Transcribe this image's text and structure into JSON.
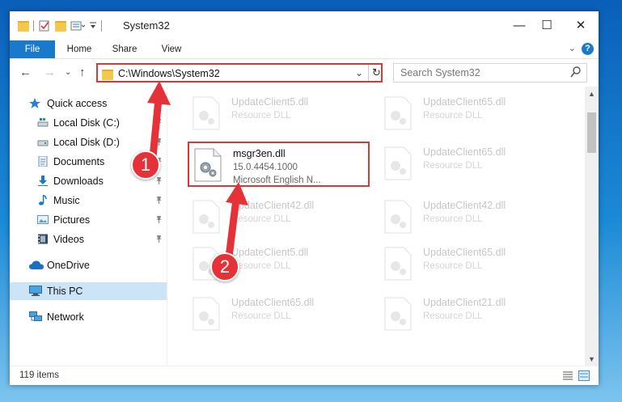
{
  "window": {
    "title": "System32",
    "controls": {
      "minimize": "—",
      "maximize": "☐",
      "close": "✕"
    }
  },
  "ribbon": {
    "tabs": [
      "File",
      "Home",
      "Share",
      "View"
    ],
    "help": "?"
  },
  "address_bar": {
    "path": "C:\\Windows\\System32",
    "search_placeholder": "Search System32"
  },
  "sidebar": {
    "items": [
      {
        "label": "Quick access",
        "icon": "star-icon"
      },
      {
        "label": "Local Disk (C:)",
        "icon": "drive-icon",
        "pinned": true
      },
      {
        "label": "Local Disk (D:)",
        "icon": "drive-icon",
        "pinned": true
      },
      {
        "label": "Documents",
        "icon": "documents-icon",
        "pinned": true
      },
      {
        "label": "Downloads",
        "icon": "download-icon",
        "pinned": true
      },
      {
        "label": "Music",
        "icon": "music-icon",
        "pinned": true
      },
      {
        "label": "Pictures",
        "icon": "pictures-icon",
        "pinned": true
      },
      {
        "label": "Videos",
        "icon": "videos-icon",
        "pinned": true
      },
      {
        "label": "OneDrive",
        "icon": "cloud-icon"
      },
      {
        "label": "This PC",
        "icon": "computer-icon",
        "selected": true
      },
      {
        "label": "Network",
        "icon": "network-icon"
      }
    ]
  },
  "files": {
    "col1": [
      {
        "name": "UpdateClient5.dll",
        "type": "Resource DLL"
      },
      {
        "name": "msgr3en.dll",
        "type": "15.0.4454.1000",
        "description": "Microsoft English N...",
        "selected": true
      },
      {
        "name": "UpdateClient42.dll",
        "type": "Resource DLL"
      },
      {
        "name": "UpdateClient5.dll",
        "type": "Resource DLL"
      },
      {
        "name": "UpdateClient65.dll",
        "type": "Resource DLL"
      }
    ],
    "col2": [
      {
        "name": "UpdateClient65.dll",
        "type": "Resource DLL"
      },
      {
        "name": "UpdateClient65.dll",
        "type": "Resource DLL"
      },
      {
        "name": "UpdateClient42.dll",
        "type": "Resource DLL"
      },
      {
        "name": "UpdateClient65.dll",
        "type": "Resource DLL"
      },
      {
        "name": "UpdateClient21.dll",
        "type": "Resource DLL"
      }
    ]
  },
  "status_bar": {
    "item_count": "119 items"
  },
  "callouts": {
    "step1": "1",
    "step2": "2"
  },
  "colors": {
    "accent": "#1979ca",
    "highlight": "#d9383a",
    "callout": "#e53238",
    "selected_bg": "#cce4f7"
  }
}
